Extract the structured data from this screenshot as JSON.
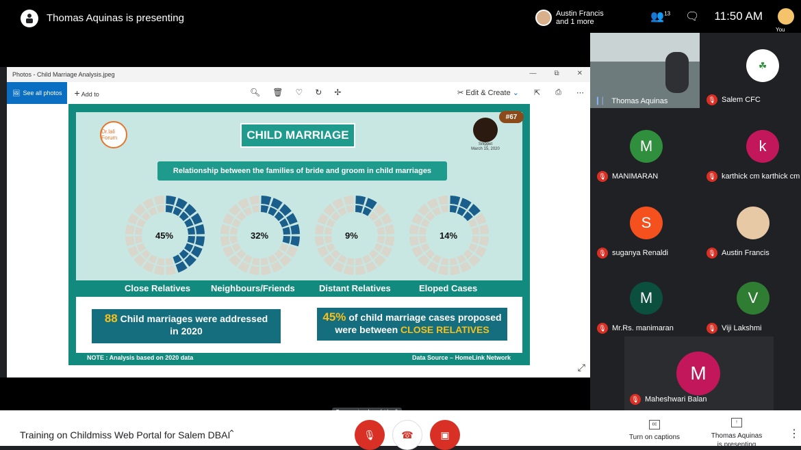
{
  "topbar": {
    "title": "Thomas Aquinas is presenting",
    "speaker_line1": "Austin Francis",
    "speaker_line2": "and 1 more",
    "participants_count": "13",
    "clock": "11:50 AM",
    "you_label": "You"
  },
  "photo_window": {
    "title": "Photos - Child Marriage Analysis.jpeg",
    "see_all": "See all photos",
    "add_to": "Add to",
    "edit_create": "Edit & Create"
  },
  "slide": {
    "title": "CHILD MARRIAGE",
    "subtitle": "Relationship between the families of bride and groom in child marriages",
    "badge": "#67",
    "logo_left": "Dr.lali Forum",
    "logo_right_caption1": "Snippet",
    "logo_right_caption2": "March 15, 2020",
    "note_left": "NOTE : Analysis based on 2020  data",
    "note_right": "Data Source – HomeLink Network",
    "stat1_number": "88",
    "stat1_text1": "Child marriages were addressed",
    "stat1_text2": "in 2020",
    "stat2_number": "45%",
    "stat2_text1": "of child marriage cases proposed",
    "stat2_text2": "were between",
    "stat2_highlight": "CLOSE RELATIVES"
  },
  "chart_data": {
    "type": "pie",
    "title": "Relationship between the families of bride and groom in child marriages",
    "categories": [
      "Close Relatives",
      "Neighbours/Friends",
      "Distant Relatives",
      "Eloped Cases"
    ],
    "values": [
      45,
      32,
      9,
      14
    ],
    "value_labels": [
      "45%",
      "32%",
      "9%",
      "14%"
    ],
    "colors": {
      "filled": "#1a5e8c",
      "empty": "#d9d6cc",
      "gap": "#c8e7e3"
    }
  },
  "participants": [
    {
      "name": "Thomas Aquinas",
      "mic": "on"
    },
    {
      "name": "Salem CFC",
      "mic": "off"
    },
    {
      "name": "MANIMARAN",
      "mic": "off",
      "initial": "M",
      "color": "#2f8f3c"
    },
    {
      "name": "karthick cm karthick cm",
      "mic": "off",
      "initial": "k",
      "color": "#c2185b"
    },
    {
      "name": "suganya Renaldi",
      "mic": "off",
      "initial": "S",
      "color": "#f4511e"
    },
    {
      "name": "Austin Francis",
      "mic": "off"
    },
    {
      "name": "Mr.Rs. manimaran",
      "mic": "off",
      "initial": "M",
      "color": "#0b4f3e"
    },
    {
      "name": "Viji Lakshmi",
      "mic": "off",
      "initial": "V",
      "color": "#2f7d32"
    },
    {
      "name": "Maheshwari Balan",
      "mic": "off",
      "initial": "M",
      "color": "#c2185b"
    }
  ],
  "bottombar": {
    "meeting_title": "Training on Childmiss Web Portal for Salem DBAI",
    "tooltip": "Turn on microphone (ctrl + d)",
    "captions": "Turn on captions",
    "presenting_line1": "Thomas Aquinas",
    "presenting_line2": "is presenting"
  }
}
